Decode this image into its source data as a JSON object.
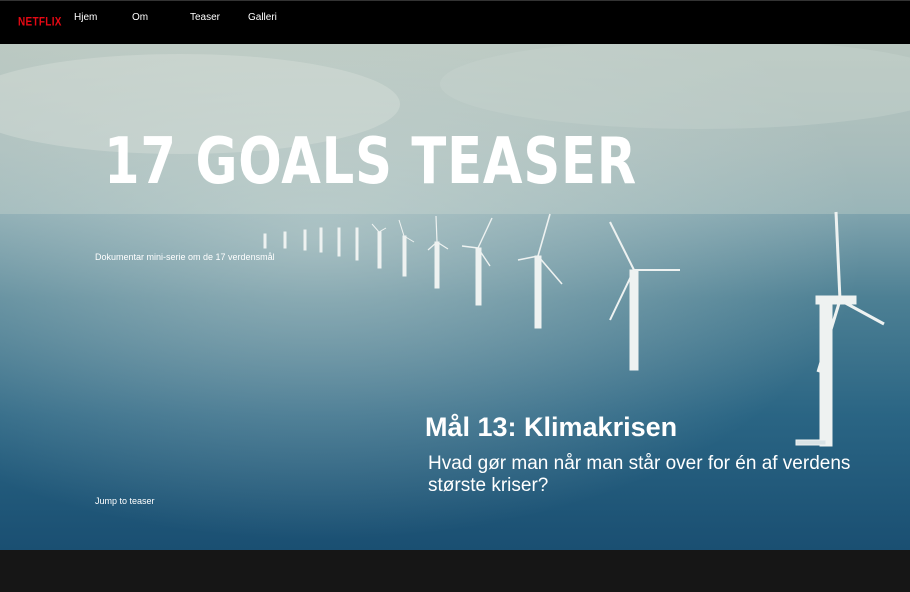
{
  "brand": {
    "logo": "NETFLIX"
  },
  "nav": {
    "items": [
      {
        "label": "Hjem"
      },
      {
        "label": "Om"
      },
      {
        "label": "Teaser"
      },
      {
        "label": "Galleri"
      }
    ]
  },
  "hero": {
    "title": "17 GOALS TEASER",
    "subtitle": "Dokumentar mini-serie om de 17 verdensmål",
    "jump_link": "Jump to teaser",
    "goal_heading": "Mål 13: Klimakrisen",
    "goal_description": "Hvad gør man når man står over for én af verdens største kriser?"
  },
  "colors": {
    "brand_red": "#e50914",
    "nav_bg": "#000000",
    "footer_bg": "#161616"
  }
}
